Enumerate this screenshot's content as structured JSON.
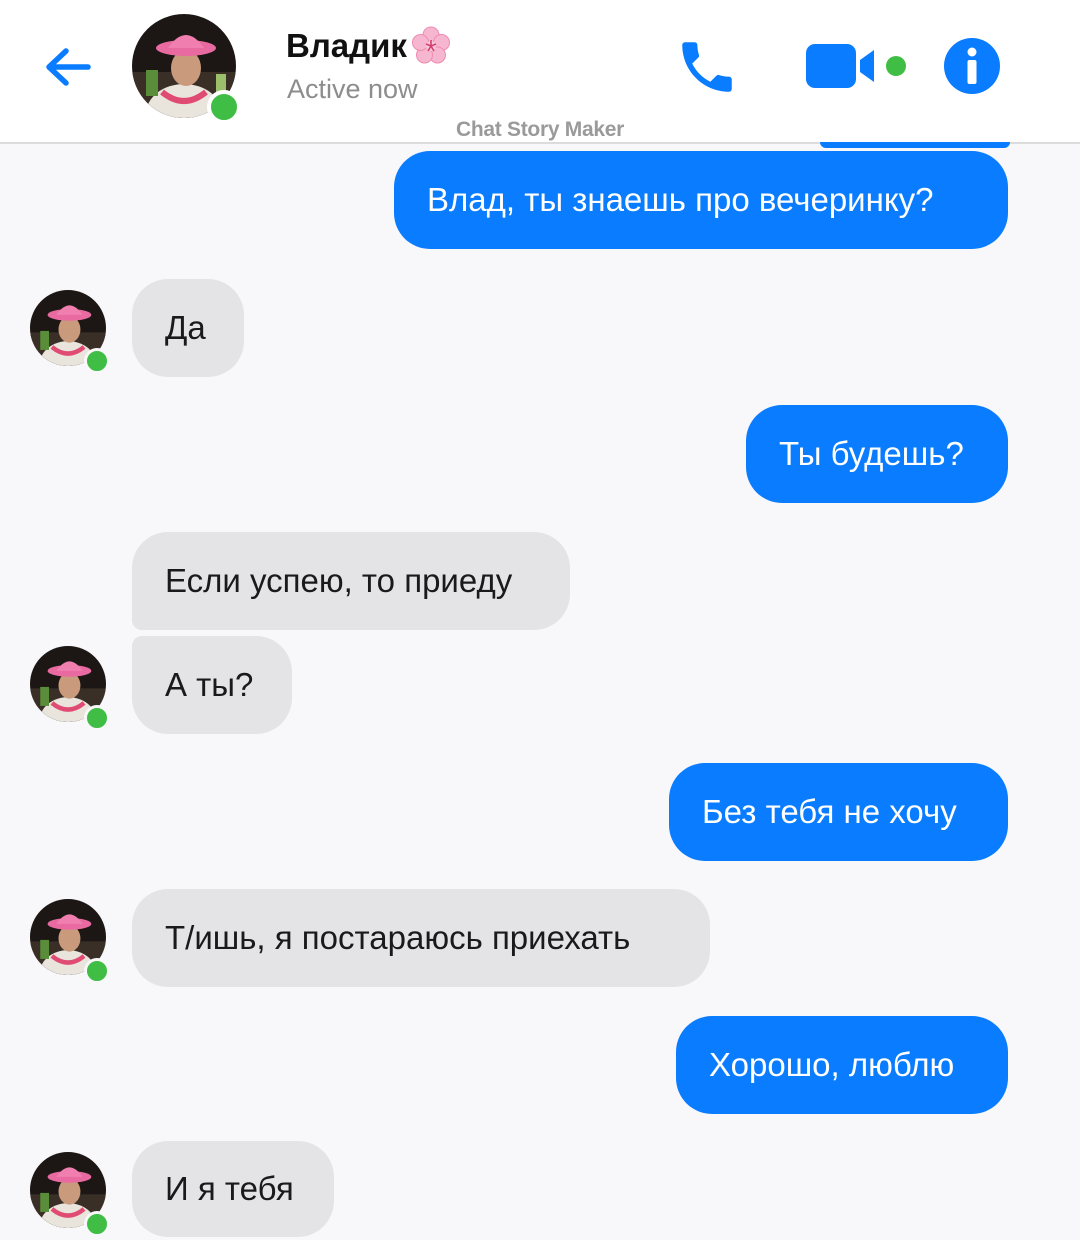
{
  "header": {
    "contact_name": "Владик",
    "status": "Active now",
    "watermark": "Chat Story Maker"
  },
  "icons": {
    "back": "arrow-left-icon",
    "call": "phone-icon",
    "video": "video-camera-icon",
    "info": "info-icon",
    "name_emoji": "cherry-blossom-icon"
  },
  "colors": {
    "accent": "#0a7cff",
    "online": "#3fbd44",
    "incoming_bubble": "#e4e4e6"
  },
  "messages": [
    {
      "side": "out",
      "text": "Влад, ты знаешь про вечеринку?"
    },
    {
      "side": "in",
      "text": "Да"
    },
    {
      "side": "out",
      "text": "Ты будешь?"
    },
    {
      "side": "in",
      "text": "Если успею, то приеду"
    },
    {
      "side": "in",
      "text": "А ты?"
    },
    {
      "side": "out",
      "text": "Без тебя не хочу"
    },
    {
      "side": "in",
      "text": "Т/ишь, я постараюсь приехать"
    },
    {
      "side": "out",
      "text": "Хорошо, люблю"
    },
    {
      "side": "in",
      "text": "И я тебя"
    }
  ]
}
